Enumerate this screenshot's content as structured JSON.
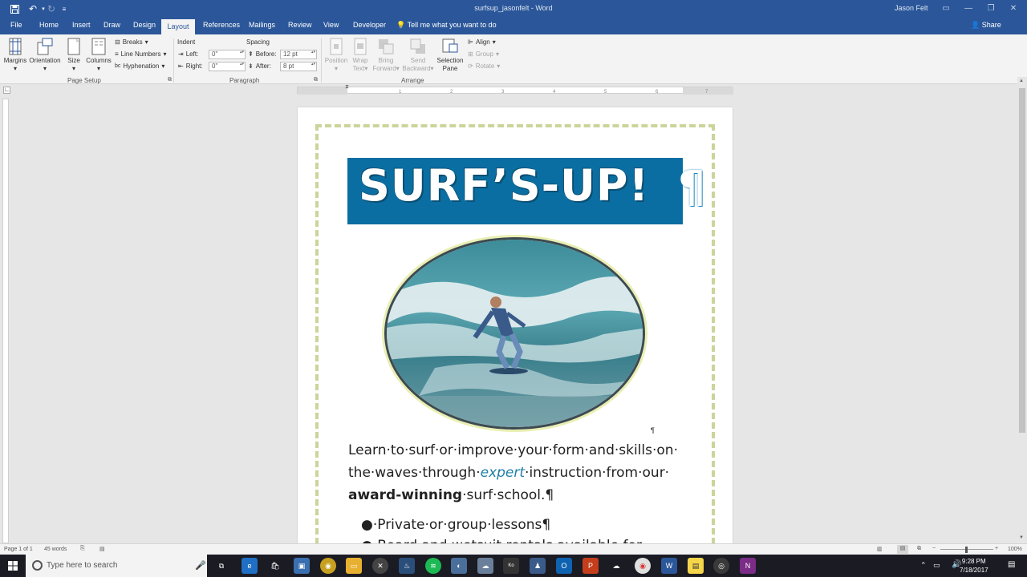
{
  "window": {
    "title": "surfsup_jasonfelt - Word",
    "user": "Jason Felt"
  },
  "tabs": [
    "File",
    "Home",
    "Insert",
    "Draw",
    "Design",
    "Layout",
    "References",
    "Mailings",
    "Review",
    "View",
    "Developer"
  ],
  "active_tab": "Layout",
  "tell_me": "Tell me what you want to do",
  "share": "Share",
  "ribbon": {
    "page_setup": {
      "margins": "Margins",
      "orientation": "Orientation",
      "size": "Size",
      "columns": "Columns",
      "breaks": "Breaks",
      "line_numbers": "Line Numbers",
      "hyphenation": "Hyphenation",
      "label": "Page Setup"
    },
    "paragraph": {
      "indent": "Indent",
      "left_label": "Left:",
      "left_value": "0\"",
      "right_label": "Right:",
      "right_value": "0\"",
      "spacing": "Spacing",
      "before_label": "Before:",
      "before_value": "12 pt",
      "after_label": "After:",
      "after_value": "8 pt",
      "label": "Paragraph"
    },
    "arrange": {
      "position": "Position",
      "wrap_1": "Wrap",
      "wrap_2": "Text",
      "bring_1": "Bring",
      "bring_2": "Forward",
      "send_1": "Send",
      "send_2": "Backward",
      "selection_1": "Selection",
      "selection_2": "Pane",
      "align": "Align",
      "group": "Group",
      "rotate": "Rotate",
      "label": "Arrange"
    }
  },
  "document": {
    "headline": "SURF’S-UP!",
    "line1": "Learn·to·surf·or·improve·your·form·and·skills·on·",
    "line2_a": "the·waves·through·",
    "line2_b": "expert",
    "line2_c": "·instruction·from·our·",
    "line3_a": "award-winning",
    "line3_b": "·surf·school.¶",
    "bullet1": "●·Private·or·group·lessons¶",
    "bullet2": "●·Board·and·wetsuit·rentals·available·for·"
  },
  "status": {
    "page": "Page 1 of 1",
    "words": "45 words",
    "zoom": "100%"
  },
  "taskbar": {
    "search_placeholder": "Type here to search",
    "time": "9:28 PM",
    "date": "7/18/2017"
  },
  "colors": {
    "word_blue": "#2b579a",
    "banner": "#0b6ea2",
    "border": "#ccd49a",
    "accent_text": "#1f7ea8"
  }
}
